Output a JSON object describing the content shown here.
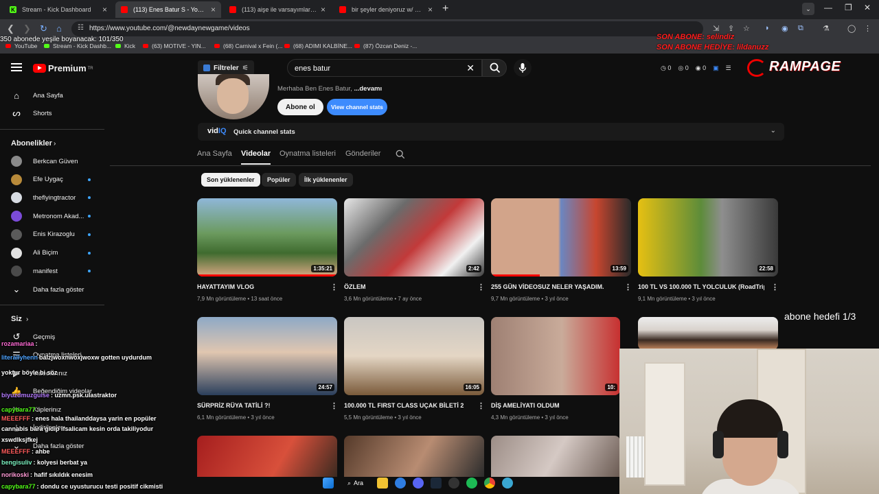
{
  "browser": {
    "tabs": [
      {
        "title": "Stream - Kick Dashboard",
        "favicon": "kick"
      },
      {
        "title": "(113) Enes Batur S - YouTube",
        "favicon": "youtube",
        "active": true
      },
      {
        "title": "(113) aişe ile varsayımlarınızı yo",
        "favicon": "youtube"
      },
      {
        "title": "bir şeyler deniyoruz w/ kübra a",
        "favicon": "youtube"
      }
    ],
    "url": "https://www.youtube.com/@newdaynewgame/videos",
    "bookmarks": [
      "YouTube",
      "Stream - Kick Dashb...",
      "Kick",
      "(63) MOTIVE - YIN...",
      "(68) Carnival x Fein (...",
      "(68) ADIMI KALBİNE...",
      "(87) Özcan Deniz -..."
    ]
  },
  "overlay": {
    "sub_counter": "350 abonede yeşile boyanacak: 101/350",
    "red_line1": "SON ABONE: selindiz",
    "red_line2": "SON ABONE HEDİYE: lildanuzz",
    "rampage": "RAMPAGE",
    "goal": "abone hedefi 1/3"
  },
  "header": {
    "logo": "Premium",
    "logo_sup": "TR",
    "filters": "Filtreler",
    "search_query": "enes batur",
    "counters": [
      "0",
      "0",
      "0"
    ]
  },
  "sidebar": {
    "main": [
      {
        "label": "Ana Sayfa",
        "icon": "home-icon"
      },
      {
        "label": "Shorts",
        "icon": "shorts-icon"
      }
    ],
    "subs_heading": "Abonelikler",
    "subs": [
      {
        "label": "Berkcan Güven",
        "color": "#8a8a8a",
        "live": false
      },
      {
        "label": "Efe Uygaç",
        "color": "#b88a3a",
        "live": true
      },
      {
        "label": "theflyingtractor",
        "color": "#d7dbe2",
        "live": true
      },
      {
        "label": "Metronom Akad...",
        "color": "#7b4bd8",
        "live": true
      },
      {
        "label": "Enis Kirazoglu",
        "color": "#5a5a5a",
        "live": true
      },
      {
        "label": "Ali Biçim",
        "color": "#e2e2e2",
        "live": true
      },
      {
        "label": "manifest",
        "color": "#4a4a4a",
        "live": true
      }
    ],
    "show_more": "Daha fazla göster",
    "you_heading": "Siz",
    "you": [
      {
        "label": "Geçmiş",
        "icon": "history-icon"
      },
      {
        "label": "Oynatma listeleri",
        "icon": "playlist-icon"
      },
      {
        "label": "Videolarınız",
        "icon": "your-videos-icon"
      },
      {
        "label": "Beğendiğim videolar",
        "icon": "like-icon"
      },
      {
        "label": "Kliplerinız",
        "icon": "clip-icon"
      },
      {
        "label": "İndirilenler",
        "icon": "download-icon"
      },
      {
        "label": "Daha fazla göster",
        "icon": "chevron-down-icon"
      }
    ]
  },
  "channel": {
    "description": "Merhaba Ben Enes Batur,",
    "more": "...devamı",
    "subscribe": "Abone ol",
    "stats_button": "View channel stats",
    "vidiq_brand": "vid",
    "vidiq_brand2": "IQ",
    "quick_stats": "Quick channel stats",
    "tabs": [
      "Ana Sayfa",
      "Videolar",
      "Oynatma listeleri",
      "Gönderiler"
    ],
    "chips": [
      "Son yüklenenler",
      "Popüler",
      "İlk yüklenenler"
    ]
  },
  "videos": [
    {
      "title": "HAYATTAYIM VLOG",
      "meta": "7,9 Mn görüntüleme • 13 saat önce",
      "duration": "1:35:21",
      "watched": 1.0
    },
    {
      "title": "ÖZLEM",
      "meta": "3,6 Mn görüntüleme • 7 ay önce",
      "duration": "2:42",
      "watched": 0.0
    },
    {
      "title": "255 GÜN VİDEOSUZ NELER YAŞADIM.",
      "meta": "9,7 Mn görüntüleme • 3 yıl önce",
      "duration": "13:59",
      "watched": 0.35
    },
    {
      "title": "100 TL VS 100.000 TL YOLCULUK (RoadTrip)",
      "meta": "9,1 Mn görüntüleme • 3 yıl önce",
      "duration": "22:58",
      "watched": 0.0
    },
    {
      "title": "SÜRPRİZ RÜYA TATİLİ ?!",
      "meta": "6,1 Mn görüntüleme • 3 yıl önce",
      "duration": "24:57",
      "watched": 0.0
    },
    {
      "title": "100.000 TL FIRST CLASS UÇAK BİLETİ 2",
      "meta": "5,5 Mn görüntüleme • 3 yıl önce",
      "duration": "16:05",
      "watched": 0.0
    },
    {
      "title": "DİŞ AMELİYATI OLDUM",
      "meta": "4,3 Mn görüntüleme • 3 yıl önce",
      "duration": "10:",
      "watched": 0.0
    },
    {
      "title": "",
      "meta": "",
      "duration": "",
      "watched": 0.0
    }
  ],
  "chat": [
    {
      "user": "rozamariaa",
      "msg": ":",
      "color": "#ff6bd5"
    },
    {
      "user": "literallyhenn",
      "msg": "balzjwoxnwoxjwoxw gotten uydurdum",
      "color": "#4da3ff"
    },
    {
      "user": "",
      "msg": "yoktur böyle bi söz",
      "color": "#ffffff"
    },
    {
      "user": "biyuzdmuzguise",
      "msg": ": uzmn.psk.ulastraktor",
      "color": "#b57bff"
    },
    {
      "user": "capybara77",
      "msg": ":",
      "color": "#53fc18"
    },
    {
      "user": "MEEEFFF",
      "msg": ": enes hala thailanddaysa yarin en popüler",
      "color": "#ff5c5c"
    },
    {
      "user": "",
      "msg": "cannabis bara gidip ifsalicam kesin orda takiliyodur",
      "color": "#ffffff"
    },
    {
      "user": "",
      "msg": "xswdlksjfkej",
      "color": "#ffffff"
    },
    {
      "user": "MEEEFFF",
      "msg": ": ahbe",
      "color": "#ff5c5c"
    },
    {
      "user": "bengisuliv",
      "msg": ": kolyesi berbat ya",
      "color": "#7cf2c0"
    },
    {
      "user": "norikoski",
      "msg": ": hafif sıkıldık enesim",
      "color": "#ff9ad5"
    },
    {
      "user": "capybara77",
      "msg": ": dondu ce uyusturucu testi positif cikmisti",
      "color": "#53fc18"
    }
  ],
  "taskbar": {
    "search": "Ara"
  }
}
